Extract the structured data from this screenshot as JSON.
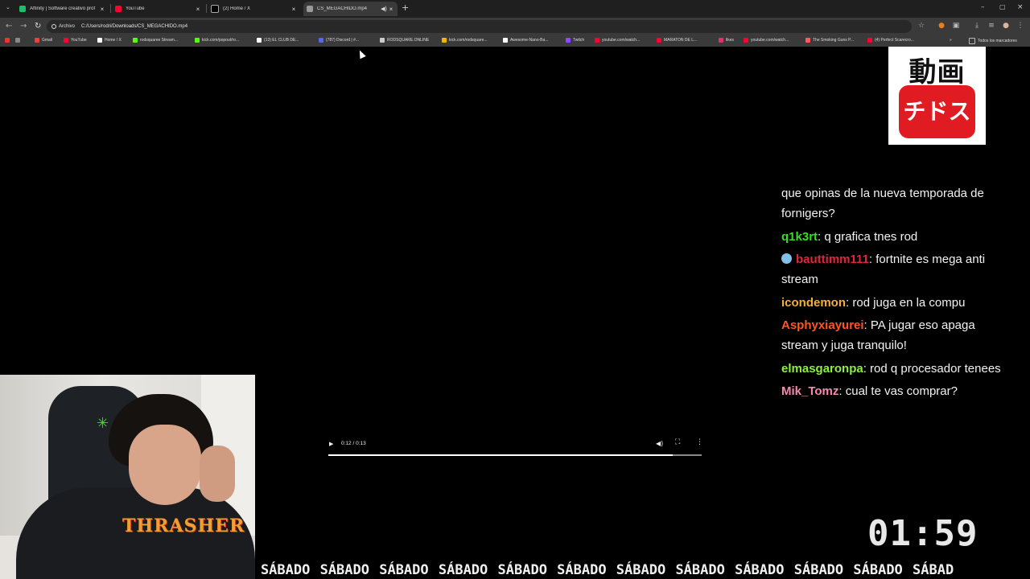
{
  "tabs": [
    {
      "title": "Affinity | Software creativo prof",
      "favicon_color": "#19c26a",
      "active": false
    },
    {
      "title": "YouTube",
      "favicon_color": "#ff0033",
      "active": false
    },
    {
      "title": "(2) Home / X",
      "favicon_color": "#000000",
      "active": false
    },
    {
      "title": "CS_MEGACHIDO.mp4",
      "favicon_color": "#9a9a9a",
      "active": true
    }
  ],
  "tab_icons": {
    "close": "×",
    "new_tab": "+",
    "audio": "speaker-icon",
    "minimize": "–",
    "maximize": "▢",
    "close_window": "×"
  },
  "address": {
    "chip_label": "Archivo",
    "url": "C:/Users/rodri/Downloads/CS_MEGACHIDO.mp4"
  },
  "bookmarks": [
    {
      "label": "Gmail",
      "color": "#ea4335"
    },
    {
      "label": "YouTube",
      "color": "#ff0033"
    },
    {
      "label": "Home / X",
      "color": "#ffffff"
    },
    {
      "label": "rodsquaree Stream...",
      "color": "#53fc18"
    },
    {
      "label": "kick.com/popout/ro...",
      "color": "#53fc18"
    },
    {
      "label": "(13) EL CLUB DE...",
      "color": "#ffffff"
    },
    {
      "label": "(787) Discord | #...",
      "color": "#5865f2"
    },
    {
      "label": "RODSQUARE.ONLINE",
      "color": "#cccccc"
    },
    {
      "label": "kick.com/rodsquare...",
      "color": "#f4b400"
    },
    {
      "label": "Awesome-Nano-Ba...",
      "color": "#ffffff"
    },
    {
      "label": "Twitch",
      "color": "#9146ff"
    },
    {
      "label": "youtube.com/watch...",
      "color": "#ff0033"
    },
    {
      "label": "MARATON DE L...",
      "color": "#ff0033"
    },
    {
      "label": "likes",
      "color": "#e1306c"
    },
    {
      "label": "youtube.com/watch...",
      "color": "#ff0033"
    },
    {
      "label": "The Smoking Guns P...",
      "color": "#ff5a5a"
    },
    {
      "label": "(4) Perfect Scarecro...",
      "color": "#ff0033"
    }
  ],
  "bookmarks_all": "Todos los marcadores",
  "logo": {
    "line1": "動画",
    "line2": "チドス"
  },
  "player": {
    "time": "0:12 / 0:13",
    "progress": 0.923
  },
  "chat": [
    {
      "user": "",
      "user_color": "#f2f2f2",
      "text": "que opinas de la nueva temporada de fornigers?",
      "emote": false
    },
    {
      "user": "q1k3rt",
      "user_color": "#35e01f",
      "text": ": q grafica tnes rod",
      "emote": false
    },
    {
      "user": "bauttimm111",
      "user_color": "#e0243a",
      "text": ": fortnite es mega anti stream",
      "emote": true
    },
    {
      "user": "icondemon",
      "user_color": "#f2b134",
      "text": ": rod juga en la compu",
      "emote": false
    },
    {
      "user": "Asphyxiayurei",
      "user_color": "#ff5622",
      "text": ": PA jugar eso apaga stream y juga tranquilo!",
      "emote": false
    },
    {
      "user": "elmasgaronpa",
      "user_color": "#8ef03c",
      "text": ": rod q procesador tenees",
      "emote": false
    },
    {
      "user": "Mik_Tomz",
      "user_color": "#f58ab0",
      "text": ": cual te vas comprar?",
      "emote": false
    }
  ],
  "clock": "01:59",
  "ticker": "ADO SÁBADO SÁBADO SÁBADO SÁBADO SÁBADO SÁBADO SÁBADO SÁBADO SÁBADO SÁBADO SÁBADO SÁBAD",
  "webcam": {
    "shirt_brand": "THRASHER"
  }
}
